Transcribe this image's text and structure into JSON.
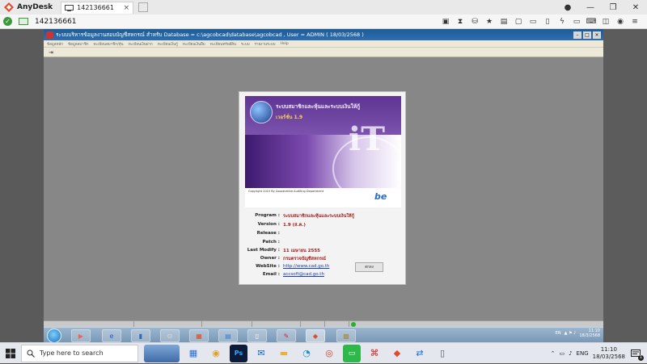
{
  "anydesk": {
    "brand": "AnyDesk",
    "tab_label": "142136661",
    "address_id": "142136661",
    "tab_close": "×",
    "win_controls": [
      "—",
      "❐",
      "✕"
    ],
    "toolbar_icons": [
      "chat-icon",
      "hourglass-icon",
      "database-icon",
      "star-icon",
      "files-icon",
      "keyboard-icon",
      "monitor-icon",
      "screen-icon",
      "bolt-icon",
      "display-icon",
      "keyboard-layout-icon",
      "privacy-icon",
      "screenshot-icon",
      "menu-icon"
    ]
  },
  "remote_app": {
    "title": "ระบบบริหารข้อมูลงานสอบบัญชีสหกรณ์ สำหรับ  Database = c:\\agcobcad\\database\\agcobcad , User = ADMIN ( 18/03/2568 )",
    "menu": [
      "ข้อมูลหลัก",
      "ข้อมูลสมาชิก",
      "ทะเบียนสมาชิก/หุ้น",
      "ทะเบียนเงินฝาก",
      "ทะเบียนเงินกู้",
      "ทะเบียนเงินยืม",
      "ทะเบียนทรัพย์สิน",
      "ระบบ",
      "รายงานระบบ",
      "Help"
    ]
  },
  "splash": {
    "banner_title": "ระบบสมาชิกและหุ้นและระบบเงินให้กู้",
    "banner_version": "เวอร์ชั่น 1.9",
    "banner_logo": "be",
    "banner_it": "iT",
    "banner_copyright": "Copyright 2010 By Cooperative Auditing Department",
    "rows": [
      {
        "label": "Program :",
        "value": "ระบบสมาชิกและหุ้นและระบบเงินให้กู้",
        "link": false
      },
      {
        "label": "Version :",
        "value": "1.9 (ส.ค.)",
        "link": false
      },
      {
        "label": "Release :",
        "value": "",
        "link": false
      },
      {
        "label": "Patch :",
        "value": "",
        "link": false
      },
      {
        "label": "Last Modify :",
        "value": "11 เมษายน 2555",
        "link": false
      },
      {
        "label": "Owner :",
        "value": "กรมตรวจบัญชีสหกรณ์",
        "link": false
      },
      {
        "label": "WebSite :",
        "value": "http://www.cad.go.th",
        "link": true
      },
      {
        "label": "Email :",
        "value": "accsoft@cad.go.th",
        "link": true
      }
    ],
    "button_label": "ตกลง"
  },
  "remote_taskbar": {
    "apps": [
      "media-player-icon",
      "ie-icon",
      "folder-icon",
      "network-icon",
      "office-icon",
      "explorer-icon",
      "file-icon",
      "pdf-icon",
      "anydesk-icon",
      "app-icon"
    ],
    "lang": "EN",
    "time": "11:10",
    "date": "18/3/2568"
  },
  "taskbar": {
    "search_placeholder": "Type here to search",
    "apps": [
      "news-widget-icon",
      "store-icon",
      "chrome-alt-icon",
      "photoshop-icon",
      "outlook-icon",
      "file-explorer-icon",
      "edge-icon",
      "chrome-icon",
      "line-icon",
      "acrobat-icon",
      "anydesk-icon",
      "teamviewer-icon",
      "document-icon"
    ],
    "lang": "ENG",
    "time": "11:10",
    "date": "18/03/2568",
    "notification_count": "1"
  },
  "colors": {
    "accent_anydesk": "#e24a2f",
    "app_title_blue": "#1d5b94",
    "splash_value": "#9e1a1a",
    "link": "#1a3fa8"
  }
}
